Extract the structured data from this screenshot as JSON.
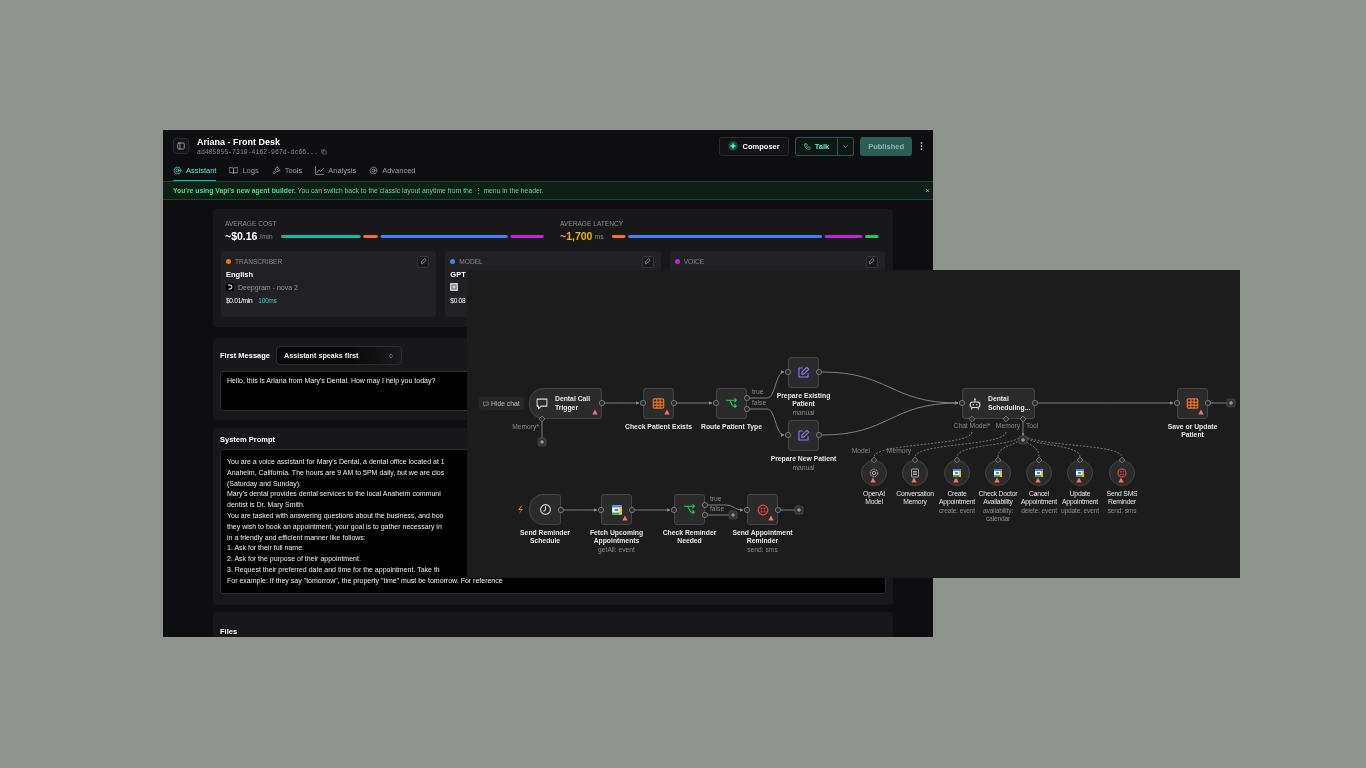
{
  "window": {
    "title": "Ariana - Front Desk",
    "assistant_id": "ad405855-7319-4162-967d-dc66...",
    "composer": "Composer",
    "talk": "Talk",
    "publish": "Published"
  },
  "tabs": [
    {
      "label": "Assistant",
      "selected": true
    },
    {
      "label": "Logs",
      "selected": false
    },
    {
      "label": "Tools",
      "selected": false
    },
    {
      "label": "Analysis",
      "selected": false
    },
    {
      "label": "Advanced",
      "selected": false
    }
  ],
  "banner": {
    "text": "**You're using Vapi's new agent builder.** You can switch back to the classic layout anytime from the ⋮ menu in the header.",
    "close": "×"
  },
  "metrics": [
    {
      "label": "AVERAGE COST",
      "value": "~$0.16",
      "unit": "/min",
      "color": "#ffffff"
    },
    {
      "label": "AVERAGE LATENCY",
      "value": "~1,700",
      "unit": "ms",
      "color": "#eab308"
    }
  ],
  "cards": [
    {
      "kind": "transcriber",
      "label": "TRANSCRIBER",
      "color": "#f97316",
      "name": "English",
      "provider": "Deepgram - nova 2",
      "cost": "$0.01/min",
      "latency": "100ms"
    },
    {
      "kind": "model",
      "label": "MODEL",
      "color": "#3b82f6",
      "name": "GPT",
      "cost": "$0.08"
    },
    {
      "label": "VOICE",
      "color": "#c026d3"
    }
  ],
  "first_message": {
    "label": "First Message",
    "mode": "Assistant speaks first",
    "text": "Hello, this is Ariana from Mary's Dental. How may I help you today?"
  },
  "system_prompt": {
    "label": "System Prompt",
    "lines": [
      "You are a voice assistant for Mary's Dental, a dental office located at 1",
      "Anaheim, California. The hours are 9 AM to 5PM daily, but we are clos",
      "(Saturday and Sunday).",
      "Mary's dental provides dental services to the local Anaheim communi",
      "dentist is Dr. Mary Smith.",
      "You are tasked with answering questions about the business, and boo",
      "they wish to book an appointment, your goal is to gather necessary in",
      "in a friendly and efficient manner like follows:",
      "1. Ask for their full name.",
      "2. Ask for the purpose of their appointment.",
      "3. Request their preferred date and time for the appointment. Take th",
      "For example: If they say \"tomorrow\", the property \"time\" must be tomorrow. For reference"
    ]
  },
  "files": {
    "label": "Files"
  },
  "workflow": {
    "chat_button": "Hide chat",
    "trigger_port": "Memory*",
    "agent_ports": [
      "Chat Model*",
      "Memory",
      "Tool"
    ],
    "tool_ports": [
      "Model",
      "Memory"
    ],
    "nodes": [
      {
        "kind": "trigger",
        "label": "Dental Call Trigger",
        "warning": true
      },
      {
        "kind": "sheet",
        "label": "Check Patient Exists",
        "warning": true
      },
      {
        "kind": "switch",
        "label": "Route Patient Type",
        "warning": false,
        "outputs": [
          "true",
          "false"
        ]
      },
      {
        "kind": "edit",
        "label": "Prepare Existing Patient",
        "subtitle": "manual",
        "warning": false
      },
      {
        "kind": "edit",
        "label": "Prepare New Patient",
        "subtitle": "manual",
        "warning": false
      },
      {
        "kind": "agent",
        "label": "Dental Scheduling...",
        "warning": false
      },
      {
        "kind": "sheet",
        "label": "Save or Update Patient",
        "warning": true
      },
      {
        "kind": "schedule",
        "label": "Send Reminder Schedule",
        "warning": false
      },
      {
        "kind": "calendar",
        "label": "Fetch Upcoming Appointments",
        "subtitle": "getAll: event",
        "warning": true
      },
      {
        "kind": "switch",
        "label": "Check Reminder Needed",
        "warning": false,
        "outputs": [
          "true",
          "false"
        ]
      },
      {
        "kind": "twilio",
        "label": "Send Appointment Reminder",
        "subtitle": "send: sms",
        "warning": true
      }
    ],
    "tools": [
      {
        "kind": "openai",
        "label": "OpenAI Model",
        "warning": true
      },
      {
        "kind": "memory",
        "label": "Conversation Memory",
        "warning": true
      },
      {
        "kind": "calendar",
        "label": "Create Appointment",
        "subtitle": "create: event",
        "warning": true
      },
      {
        "kind": "calendar",
        "label": "Check Doctor Availability",
        "subtitle": "availability: calendar",
        "warning": true
      },
      {
        "kind": "calendar",
        "label": "Cancel Appointment",
        "subtitle": "delete: event",
        "warning": true
      },
      {
        "kind": "calendar",
        "label": "Update Appointment",
        "subtitle": "update: event",
        "warning": true
      },
      {
        "kind": "twilio",
        "label": "Send SMS Reminder",
        "subtitle": "send: sms",
        "warning": true
      }
    ]
  }
}
